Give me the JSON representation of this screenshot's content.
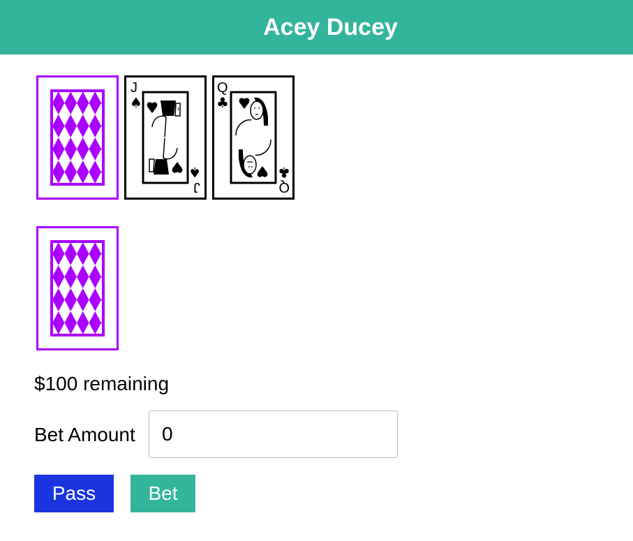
{
  "header": {
    "title": "Acey Ducey"
  },
  "colors": {
    "header_bg": "#33b59b",
    "card_back": "#aa00ff",
    "pass_button": "#1a35e0",
    "bet_button": "#33b59b"
  },
  "cards": {
    "top_row": [
      {
        "kind": "back",
        "icon": "card-back-icon"
      },
      {
        "kind": "face",
        "rank": "J",
        "suit": "spades",
        "suit_symbol": "♠",
        "icon": "jack-of-spades-icon"
      },
      {
        "kind": "face",
        "rank": "Q",
        "suit": "clubs",
        "suit_symbol": "♣",
        "icon": "queen-of-clubs-icon"
      }
    ],
    "middle": {
      "kind": "back",
      "icon": "card-back-icon"
    }
  },
  "status": {
    "remaining_text": "$100 remaining"
  },
  "bet": {
    "label": "Bet Amount",
    "value": "0"
  },
  "buttons": {
    "pass_label": "Pass",
    "bet_label": "Bet"
  }
}
